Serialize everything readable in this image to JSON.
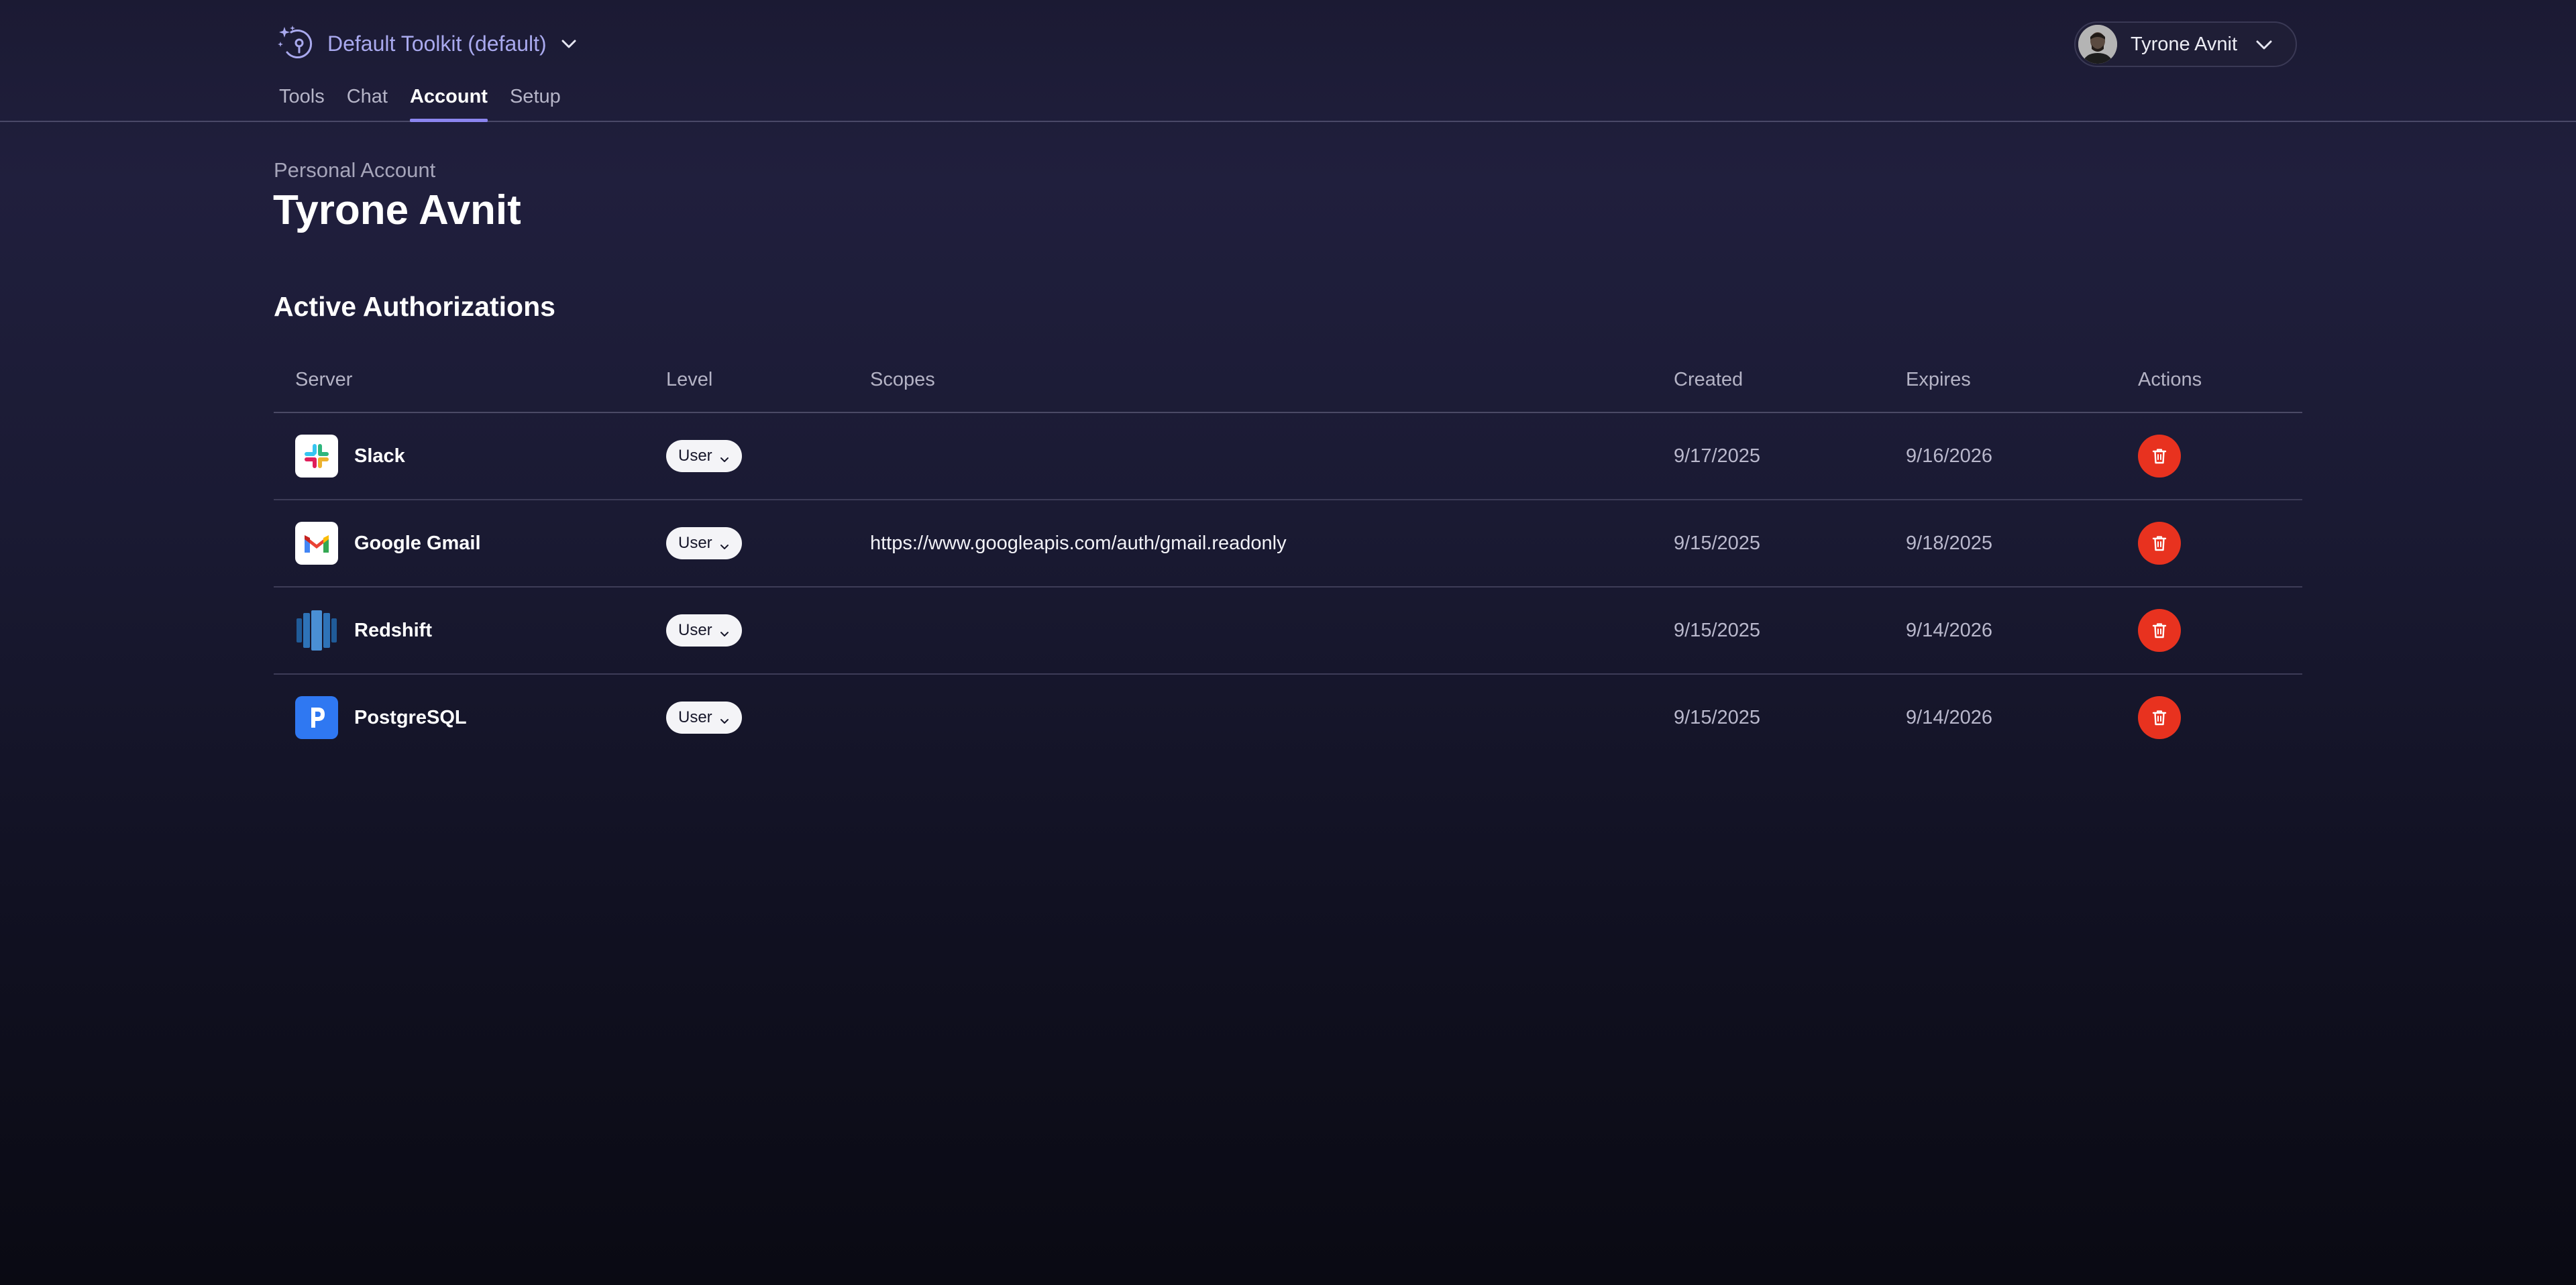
{
  "header": {
    "toolkit_name": "Default Toolkit (default)",
    "tabs": [
      {
        "label": "Tools",
        "active": false
      },
      {
        "label": "Chat",
        "active": false
      },
      {
        "label": "Account",
        "active": true
      },
      {
        "label": "Setup",
        "active": false
      }
    ],
    "user_name": "Tyrone Avnit",
    "accent_color": "#8b85ef"
  },
  "page": {
    "subtitle": "Personal Account",
    "title": "Tyrone Avnit",
    "section_title": "Active Authorizations"
  },
  "table": {
    "columns": {
      "server": "Server",
      "level": "Level",
      "scopes": "Scopes",
      "created": "Created",
      "expires": "Expires",
      "actions": "Actions"
    },
    "rows": [
      {
        "server": "Slack",
        "icon": "slack-logo-icon",
        "level": "User",
        "scopes": "",
        "created": "9/17/2025",
        "expires": "9/16/2026"
      },
      {
        "server": "Google Gmail",
        "icon": "gmail-logo-icon",
        "level": "User",
        "scopes": "https://www.googleapis.com/auth/gmail.readonly",
        "created": "9/15/2025",
        "expires": "9/18/2025"
      },
      {
        "server": "Redshift",
        "icon": "redshift-logo-icon",
        "level": "User",
        "scopes": "",
        "created": "9/15/2025",
        "expires": "9/14/2026"
      },
      {
        "server": "PostgreSQL",
        "icon": "postgresql-logo-icon",
        "level": "User",
        "scopes": "",
        "created": "9/15/2025",
        "expires": "9/14/2026"
      }
    ],
    "delete_color": "#e8321f"
  }
}
